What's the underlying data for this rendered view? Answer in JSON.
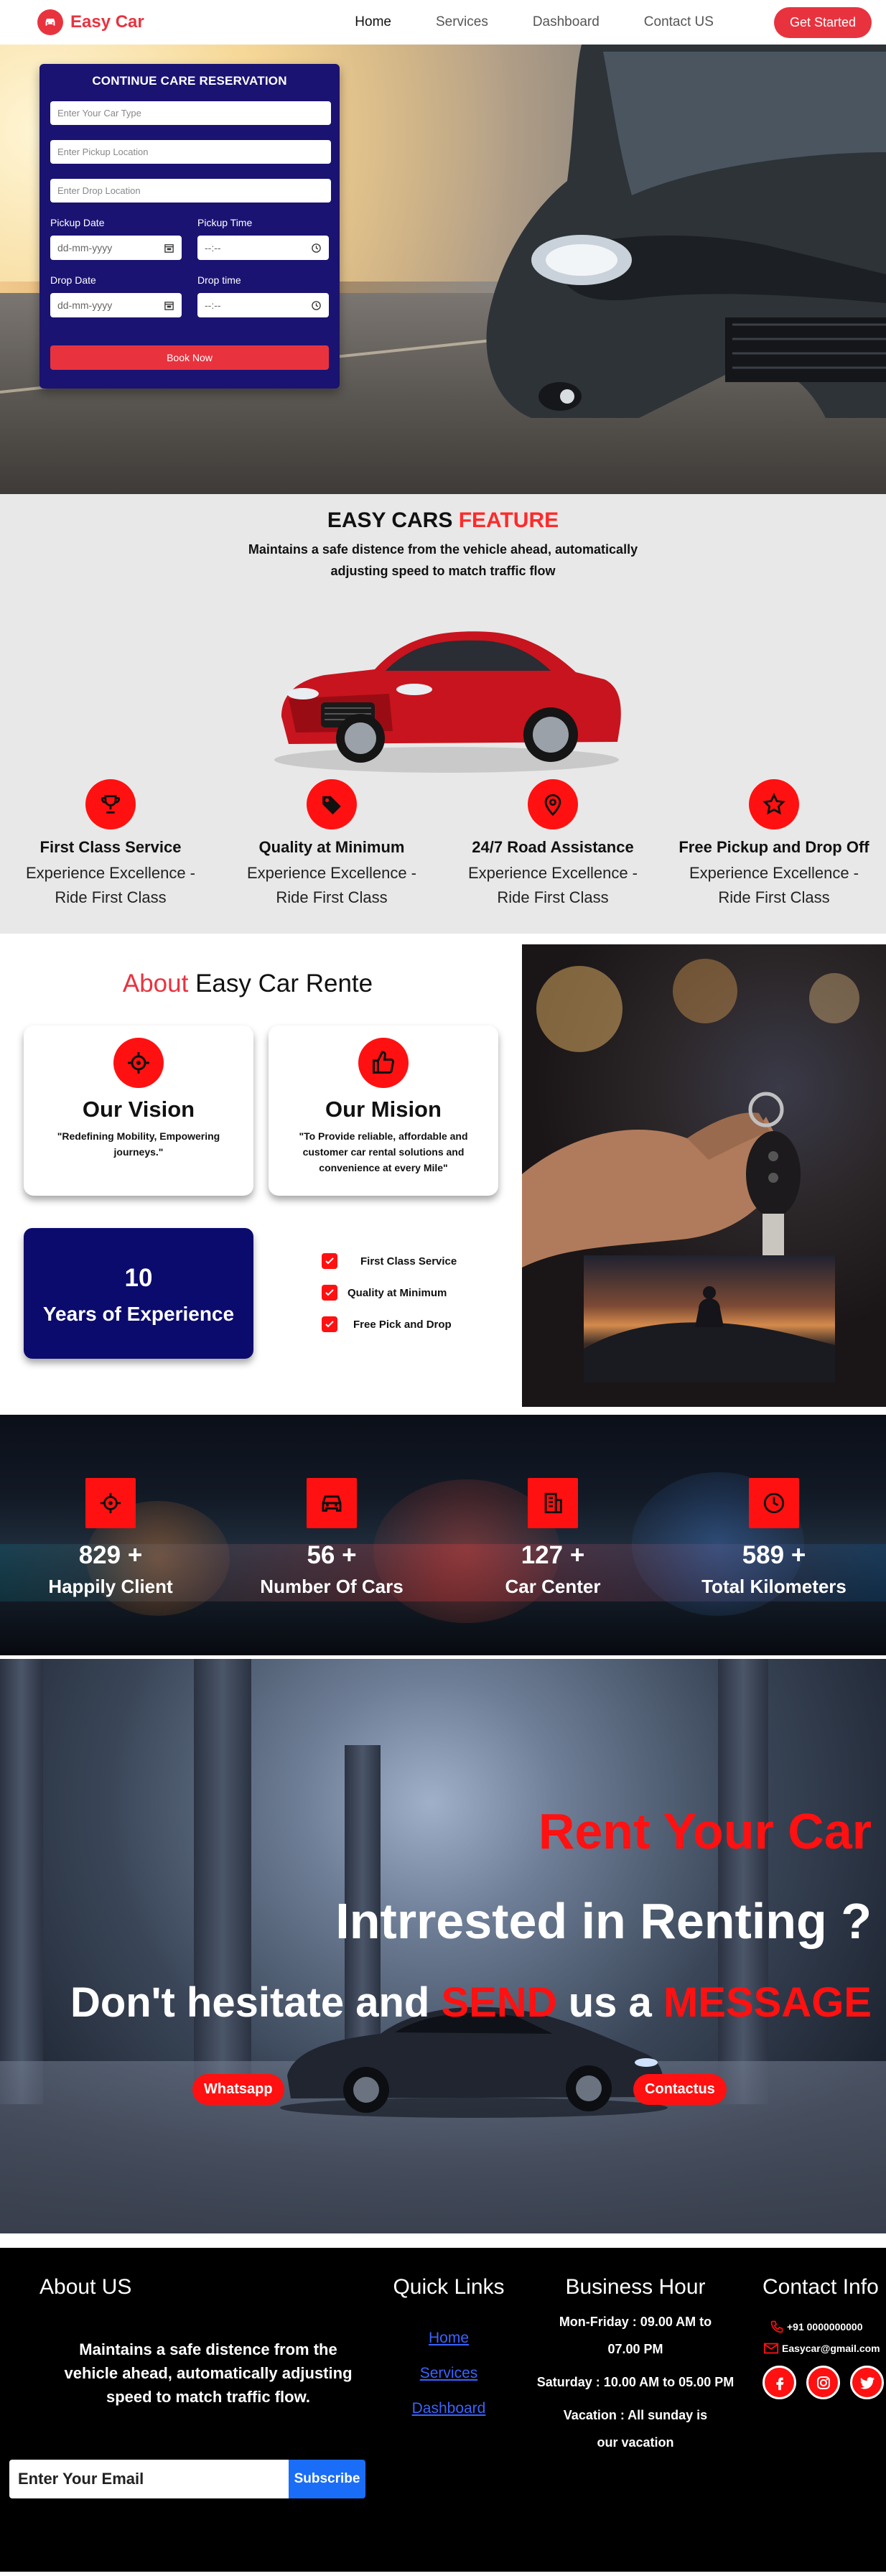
{
  "nav": {
    "brand": "Easy Car",
    "links": [
      "Home",
      "Services",
      "Dashboard",
      "Contact US"
    ],
    "cta": "Get Started"
  },
  "booking": {
    "title": "CONTINUE CARE RESERVATION",
    "car_type_placeholder": "Enter Your Car Type",
    "pickup_location_placeholder": "Enter Pickup Location",
    "drop_location_placeholder": "Enter Drop Location",
    "pickup_date_label": "Pickup Date",
    "pickup_date_value": "dd-mm-yyyy",
    "pickup_time_label": "Pickup Time",
    "pickup_time_value": "--:--",
    "drop_date_label": "Drop Date",
    "drop_date_value": "dd-mm-yyyy",
    "drop_time_label": "Drop time",
    "drop_time_value": "--:--",
    "button": "Book Now"
  },
  "features": {
    "title_a": "EASY CARS",
    "title_b": "FEATURE",
    "subtitle": "Maintains a safe distence from the vehicle ahead, automatically adjusting speed to match traffic flow",
    "items": [
      {
        "title": "First Class Service",
        "desc": "Experience Excellence - Ride First Class",
        "icon": "trophy-icon"
      },
      {
        "title": "Quality at Minimum",
        "desc": "Experience Excellence - Ride First Class",
        "icon": "tag-icon"
      },
      {
        "title": "24/7 Road Assistance",
        "desc": "Experience Excellence - Ride First Class",
        "icon": "map-pin-icon"
      },
      {
        "title": "Free Pickup and Drop Off",
        "desc": "Experience Excellence - Ride First Class",
        "icon": "star-icon"
      }
    ]
  },
  "about": {
    "title_a": "About",
    "title_b": "Easy Car Rente",
    "vision": {
      "title": "Our Vision",
      "desc": "\"Redefining Mobility, Empowering journeys.\""
    },
    "mission": {
      "title": "Our Mision",
      "desc": "\"To Provide reliable, affordable and customer car rental solutions and convenience at every Mile\""
    },
    "experience": {
      "number": "10",
      "label": "Years of Experience"
    },
    "checks": [
      "First Class Service",
      "Quality at Minimum",
      "Free Pick and Drop"
    ]
  },
  "stats": [
    {
      "number": "829 +",
      "label": "Happily Client",
      "icon": "target-icon"
    },
    {
      "number": "56 +",
      "label": "Number Of Cars",
      "icon": "car-icon"
    },
    {
      "number": "127 +",
      "label": "Car Center",
      "icon": "building-icon"
    },
    {
      "number": "589 +",
      "label": "Total Kilometers",
      "icon": "clock-icon"
    }
  ],
  "rent": {
    "line1": "Rent Your Car",
    "line2": "Intrrested in Renting ?",
    "line3_a": "Don't hesitate and",
    "line3_b": "SEND",
    "line3_c": "us a",
    "line3_d": "MESSAGE",
    "whatsapp": "Whatsapp",
    "contact": "Contactus"
  },
  "footer": {
    "about_title": "About US",
    "about_text": "Maintains a safe distence from the vehicle ahead, automatically adjusting speed to match traffic flow.",
    "links_title": "Quick Links",
    "links": [
      "Home",
      "Services",
      "Dashboard"
    ],
    "hours_title": "Business Hour",
    "hours": [
      "Mon-Friday : 09.00 AM to 07.00 PM",
      "Saturday : 10.00 AM to 05.00 PM",
      "Vacation : All sunday is our vacation"
    ],
    "contact_title": "Contact Info",
    "phone": "+91 0000000000",
    "email": "Easycar@gmail.com",
    "subscribe_placeholder": "Enter Your Email",
    "subscribe_button": "Subscribe"
  },
  "colors": {
    "accent": "#e8333f",
    "feature_red": "#ff1111",
    "booking_bg": "#1a1372",
    "link_blue": "#3a63ff"
  }
}
